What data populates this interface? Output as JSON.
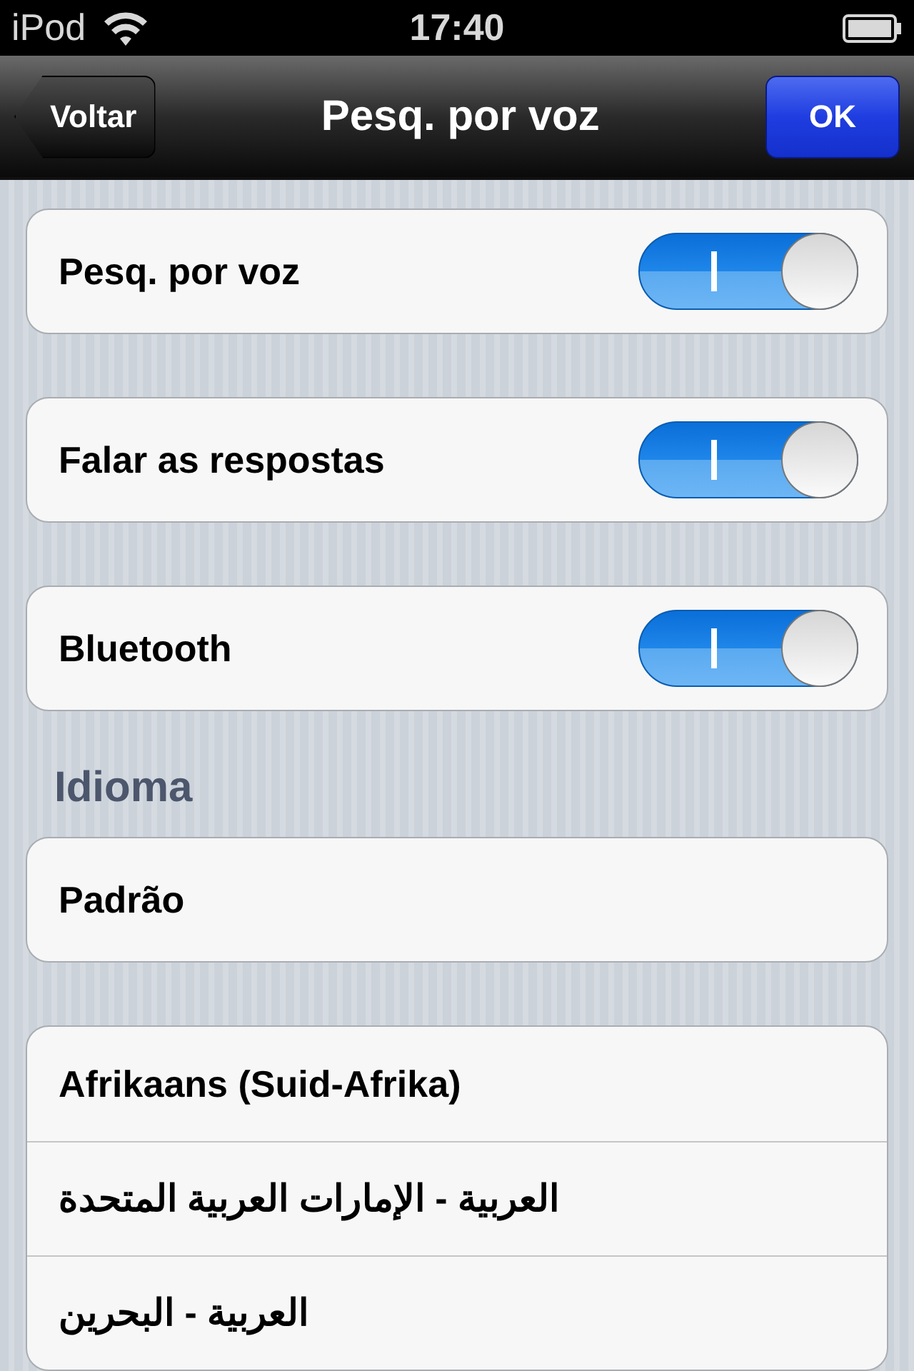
{
  "status_bar": {
    "carrier": "iPod",
    "time": "17:40"
  },
  "nav_bar": {
    "back": "Voltar",
    "title": "Pesq. por voz",
    "done": "OK"
  },
  "toggles": [
    {
      "label": "Pesq. por voz",
      "on": true
    },
    {
      "label": "Falar as respostas",
      "on": true
    },
    {
      "label": "Bluetooth",
      "on": true
    }
  ],
  "language_section": {
    "header": "Idioma",
    "default": "Padrão",
    "languages": [
      "Afrikaans (Suid-Afrika)",
      "العربية - الإمارات العربية المتحدة",
      "العربية - البحرين"
    ]
  }
}
